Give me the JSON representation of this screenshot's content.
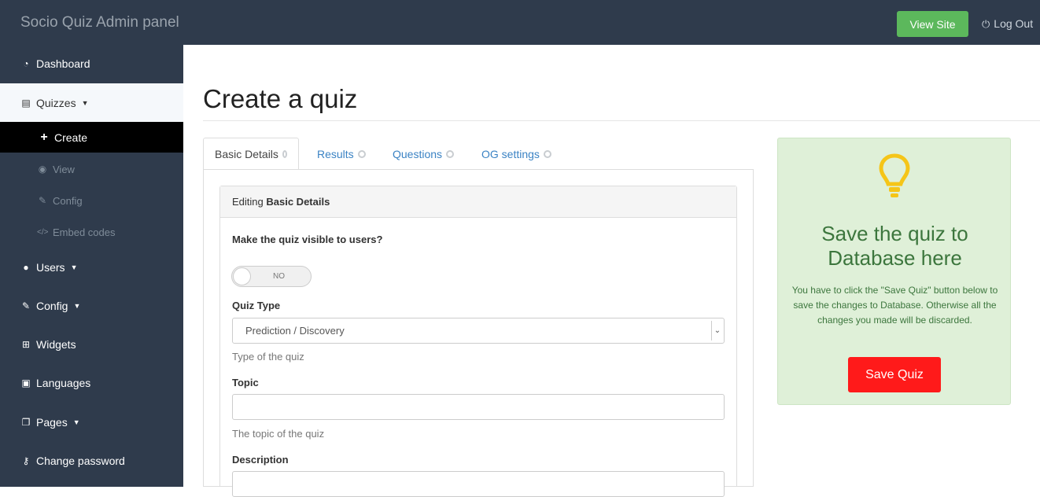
{
  "header": {
    "brand": "Socio Quiz Admin panel",
    "view_site": "View Site",
    "logout": "Log Out"
  },
  "sidebar": {
    "items": [
      {
        "label": "Dashboard",
        "icon": "dashboard-icon"
      },
      {
        "label": "Quizzes",
        "icon": "file-icon"
      },
      {
        "label": "Create",
        "icon": "plus-icon"
      },
      {
        "label": "View",
        "icon": "eye-icon"
      },
      {
        "label": "Config",
        "icon": "wrench-icon"
      },
      {
        "label": "Embed codes",
        "icon": "code-icon"
      },
      {
        "label": "Users",
        "icon": "user-icon"
      },
      {
        "label": "Config",
        "icon": "wrench-icon"
      },
      {
        "label": "Widgets",
        "icon": "sitemap-icon"
      },
      {
        "label": "Languages",
        "icon": "translate-icon"
      },
      {
        "label": "Pages",
        "icon": "pages-icon"
      },
      {
        "label": "Change password",
        "icon": "key-icon"
      }
    ]
  },
  "main": {
    "title": "Create a quiz",
    "tabs": [
      {
        "label": "Basic Details"
      },
      {
        "label": "Results"
      },
      {
        "label": "Questions"
      },
      {
        "label": "OG settings"
      }
    ],
    "card": {
      "head_prefix": "Editing",
      "head_bold": "Basic Details",
      "visible_label": "Make the quiz visible to users?",
      "toggle_text": "NO",
      "quiz_type_label": "Quiz Type",
      "quiz_type_value": "Prediction / Discovery",
      "quiz_type_help": "Type of the quiz",
      "topic_label": "Topic",
      "topic_value": "",
      "topic_help": "The topic of the quiz",
      "description_label": "Description",
      "description_value": ""
    }
  },
  "notice": {
    "title": "Save the quiz to Database here",
    "text": "You have to click the \"Save Quiz\" button below to save the changes to Database. Otherwise all the changes you made will be discarded.",
    "button": "Save Quiz"
  },
  "colors": {
    "sidebar_bg": "#2f3b4c",
    "view_site_green": "#5cb85c",
    "save_red": "#ff1a1a",
    "notice_bg": "#dff0d8",
    "notice_text": "#3c763d",
    "bulb": "#f5c518"
  }
}
